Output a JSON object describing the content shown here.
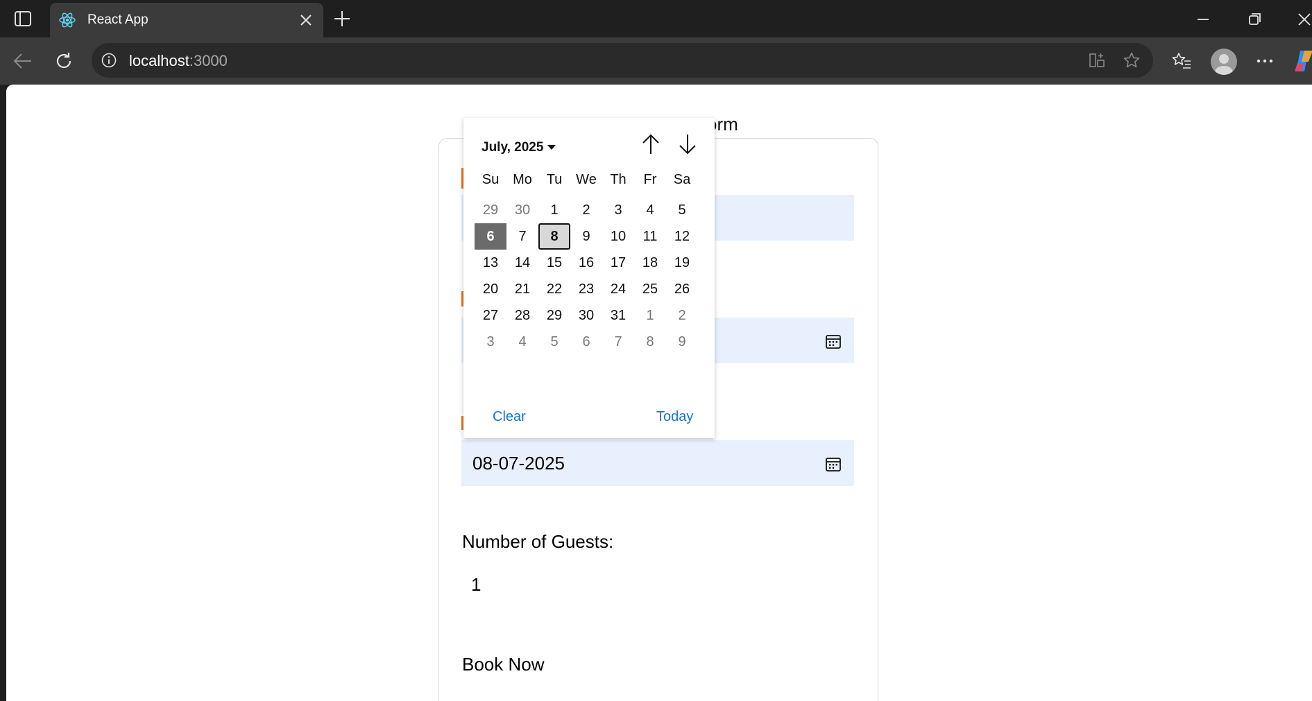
{
  "browser": {
    "tab_title": "React App",
    "url_host": "localhost",
    "url_port": ":3000"
  },
  "page": {
    "heading_fragment": "orm",
    "date_field_value": "08-07-2025",
    "guests_label": "Number of Guests:",
    "guests_value": "1",
    "submit_label": "Book Now"
  },
  "datepicker": {
    "month_label": "July, 2025",
    "weekdays": [
      "Su",
      "Mo",
      "Tu",
      "We",
      "Th",
      "Fr",
      "Sa"
    ],
    "weeks": [
      [
        {
          "d": "29",
          "m": true
        },
        {
          "d": "30",
          "m": true
        },
        {
          "d": "1"
        },
        {
          "d": "2"
        },
        {
          "d": "3"
        },
        {
          "d": "4"
        },
        {
          "d": "5"
        }
      ],
      [
        {
          "d": "6",
          "s": true
        },
        {
          "d": "7"
        },
        {
          "d": "8",
          "t": true
        },
        {
          "d": "9"
        },
        {
          "d": "10"
        },
        {
          "d": "11"
        },
        {
          "d": "12"
        }
      ],
      [
        {
          "d": "13"
        },
        {
          "d": "14"
        },
        {
          "d": "15"
        },
        {
          "d": "16"
        },
        {
          "d": "17"
        },
        {
          "d": "18"
        },
        {
          "d": "19"
        }
      ],
      [
        {
          "d": "20"
        },
        {
          "d": "21"
        },
        {
          "d": "22"
        },
        {
          "d": "23"
        },
        {
          "d": "24"
        },
        {
          "d": "25"
        },
        {
          "d": "26"
        }
      ],
      [
        {
          "d": "27"
        },
        {
          "d": "28"
        },
        {
          "d": "29"
        },
        {
          "d": "30"
        },
        {
          "d": "31"
        },
        {
          "d": "1",
          "m": true
        },
        {
          "d": "2",
          "m": true
        }
      ],
      [
        {
          "d": "3",
          "m": true
        },
        {
          "d": "4",
          "m": true
        },
        {
          "d": "5",
          "m": true
        },
        {
          "d": "6",
          "m": true
        },
        {
          "d": "7",
          "m": true
        },
        {
          "d": "8",
          "m": true
        },
        {
          "d": "9",
          "m": true
        }
      ]
    ],
    "clear_label": "Clear",
    "today_label": "Today"
  },
  "colors": {
    "chrome_dark": "#1f1f1f",
    "chrome_toolbar": "#3b3b3b",
    "input_fill": "#e8f0fe",
    "link_blue": "#1a73c8",
    "selected_day": "#6b6b6b"
  }
}
